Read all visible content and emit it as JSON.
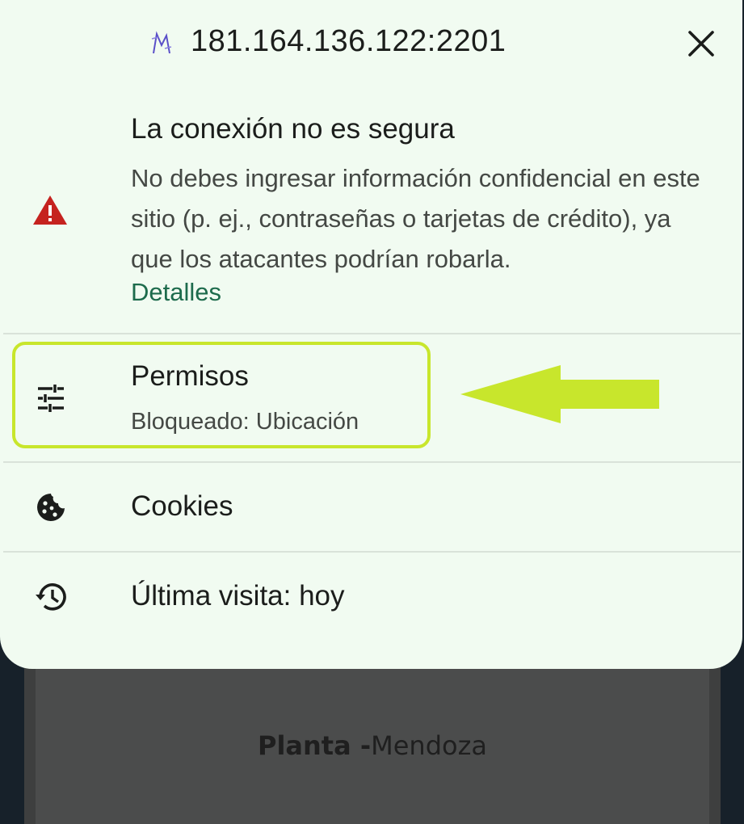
{
  "background": {
    "card_title_bold": "Planta -",
    "card_title_rest": "Mendoza"
  },
  "header": {
    "site_icon": "site-favicon-icon",
    "url": "181.164.136.122:2201",
    "close_icon": "close-icon"
  },
  "security": {
    "icon": "warning-icon",
    "title": "La conexión no es segura",
    "description": "No debes ingresar información confidencial en este sitio (p. ej., contraseñas o tarjetas de crédito), ya que los atacantes podrían robarla.",
    "details_link": "Detalles",
    "warning_color": "#c5221f",
    "link_color": "#1d6b4c"
  },
  "permissions": {
    "icon": "tune-icon",
    "title": "Permisos",
    "subtitle": "Bloqueado: Ubicación",
    "highlight_color": "#c8e62c"
  },
  "cookies": {
    "icon": "cookie-icon",
    "title": "Cookies"
  },
  "history": {
    "icon": "history-icon",
    "title": "Última visita: hoy"
  }
}
